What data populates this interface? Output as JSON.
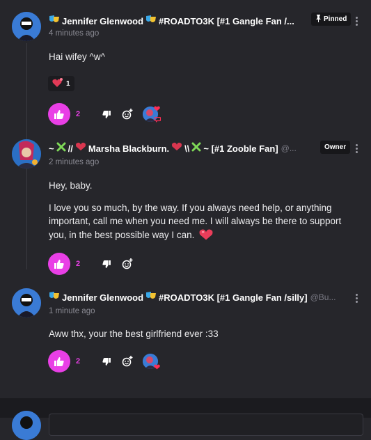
{
  "comments": [
    {
      "name": "Jennifer Glenwood",
      "tag": "#ROADTO3K [#1 Gangle Fan /...",
      "badge": "Pinned",
      "time": "4 minutes ago",
      "body": [
        "Hai wifey ^w^"
      ],
      "reactions": [
        {
          "emoji": "heart-emoji",
          "count": "1"
        }
      ],
      "likes": "2"
    },
    {
      "name_prefix": "~",
      "name_sep": "//",
      "name": "Marsha Blackburn.",
      "name_sep2": "\\\\",
      "name_suffix": "~ [#1 Zooble Fan]",
      "handle": "@...",
      "badge": "Owner",
      "time": "2 minutes ago",
      "body": [
        "Hey, baby.",
        "I love you so much, by the way. If you always need help, or anything important, call me when you need me. I will always be there to support you, in the best possible way I can."
      ],
      "likes": "2"
    },
    {
      "name": "Jennifer Glenwood",
      "tag": "#ROADTO3K [#1 Gangle Fan /silly]",
      "handle": "@Bu...",
      "time": "1 minute ago",
      "body": [
        "Aww thx, your the best girlfriend ever :33"
      ],
      "likes": "2"
    }
  ],
  "colors": {
    "accent": "#e93fe6",
    "background": "#26262b",
    "badge_bg": "#17171a"
  }
}
